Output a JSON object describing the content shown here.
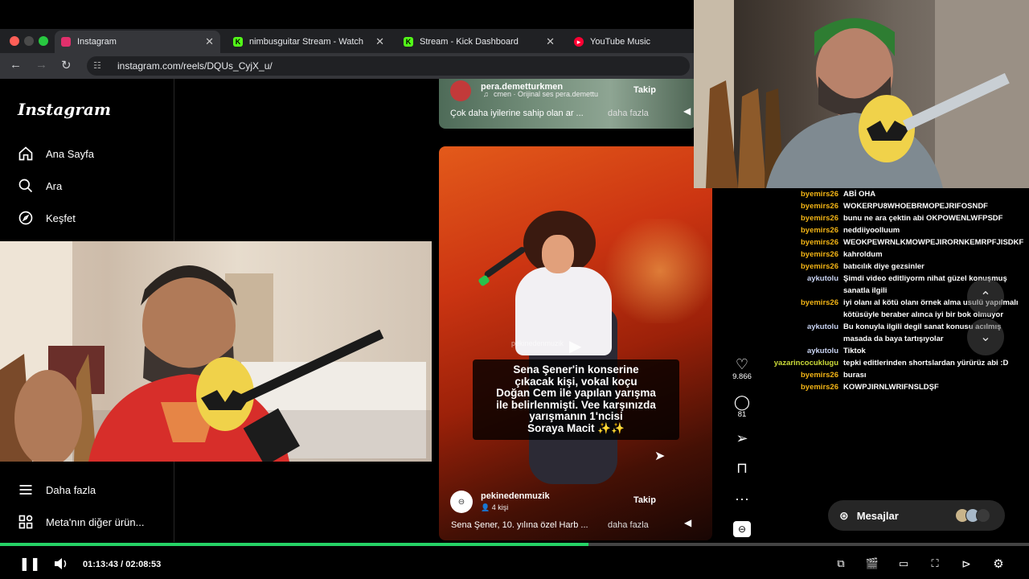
{
  "browser": {
    "tabs": [
      {
        "label": "Instagram",
        "favicon_color": "#e1306c",
        "active": true
      },
      {
        "label": "nimbusguitar Stream - Watch",
        "favicon_color": "#53fc18",
        "active": false
      },
      {
        "label": "Stream - Kick Dashboard",
        "favicon_color": "#53fc18",
        "active": false
      },
      {
        "label": "YouTube Music",
        "favicon_color": "#ff0033",
        "active": false
      }
    ],
    "url": "instagram.com/reels/DQUs_CyjX_u/"
  },
  "instagram": {
    "logo": "Instagram",
    "nav": [
      {
        "label": "Ana Sayfa",
        "icon": "home-icon"
      },
      {
        "label": "Ara",
        "icon": "search-icon"
      },
      {
        "label": "Keşfet",
        "icon": "compass-icon"
      }
    ],
    "bottom_nav": [
      {
        "label": "Daha fazla",
        "icon": "menu-icon"
      },
      {
        "label": "Meta'nın diğer ürün...",
        "icon": "meta-apps-icon"
      }
    ]
  },
  "reel_top": {
    "author": "pera.demetturkmen",
    "audio": "cmen · Orijinal ses pera.demettu",
    "follow": "Takip",
    "caption": "Çok daha iyilerine sahip olan ar ...",
    "more": "daha fazla"
  },
  "reel_main": {
    "watermark": "pekinedenmuzik",
    "overlay_text": [
      "Sena Şener'in konserine",
      "çıkacak kişi, vokal koçu",
      "Doğan Cem ile yapılan yarışma",
      "ile belirlenmişti. Vee karşınızda",
      "yarışmanın 1'ncisi",
      "Soraya Macit ✨✨"
    ],
    "author": "pekinedenmuzik",
    "people": "4 kişi",
    "follow": "Takip",
    "caption": "Sena Şener, 10. yılına özel Harb ...",
    "more": "daha fazla"
  },
  "actions": {
    "likes": "9.866",
    "comments": "81"
  },
  "chat": {
    "messages": [
      {
        "user": "",
        "text": "",
        "style": "yellow"
      },
      {
        "user": "byemirs26",
        "text": "ABİ OHA",
        "style": "yellow"
      },
      {
        "user": "byemirs26",
        "text": "WOKERPU8WHOEBRMOPEJRIFOSNDF",
        "style": "yellow"
      },
      {
        "user": "byemirs26",
        "text": "bunu ne ara çektin abi OKPOWENLWFPSDF",
        "style": "yellow"
      },
      {
        "user": "byemirs26",
        "text": "neddiiyoolluum",
        "style": "yellow"
      },
      {
        "user": "byemirs26",
        "text": "WEOKPEWRNLKMOWPEJIRORNKEMRPFJISDKF",
        "style": "yellow"
      },
      {
        "user": "byemirs26",
        "text": "kahroldum",
        "style": "yellow"
      },
      {
        "user": "byemirs26",
        "text": "batıcılık diye gezsinler",
        "style": "yellow"
      },
      {
        "user": "aykutolu",
        "text": "Şimdi video editliyorm nihat güzel konuşmuş sanatla ilgili",
        "style": "alt"
      },
      {
        "user": "byemirs26",
        "text": "iyi olanı al kötü olanı örnek alma usulü yapılmalı kötüsüyle beraber alınca iyi bir bok olmuyor",
        "style": "yellow"
      },
      {
        "user": "aykutolu",
        "text": "Bu konuyla ilgili degil sanat konusu acılmış masada da baya tartışıyolar",
        "style": "alt"
      },
      {
        "user": "aykutolu",
        "text": "Tiktok",
        "style": "alt"
      },
      {
        "user": "yazarincocuklugu",
        "text": "tepki editlerinden shortslardan yürürüz abi :D",
        "style": "green"
      },
      {
        "user": "byemirs26",
        "text": "burası",
        "style": "yellow"
      },
      {
        "user": "byemirs26",
        "text": "KOWPJIRNLWRIFNSLDŞF",
        "style": "yellow"
      }
    ]
  },
  "messages_pill": {
    "label": "Mesajlar"
  },
  "player": {
    "current_time": "01:13:43",
    "separator": "/",
    "duration": "02:08:53",
    "progress_fraction": 0.572,
    "accent": "#25d366"
  }
}
